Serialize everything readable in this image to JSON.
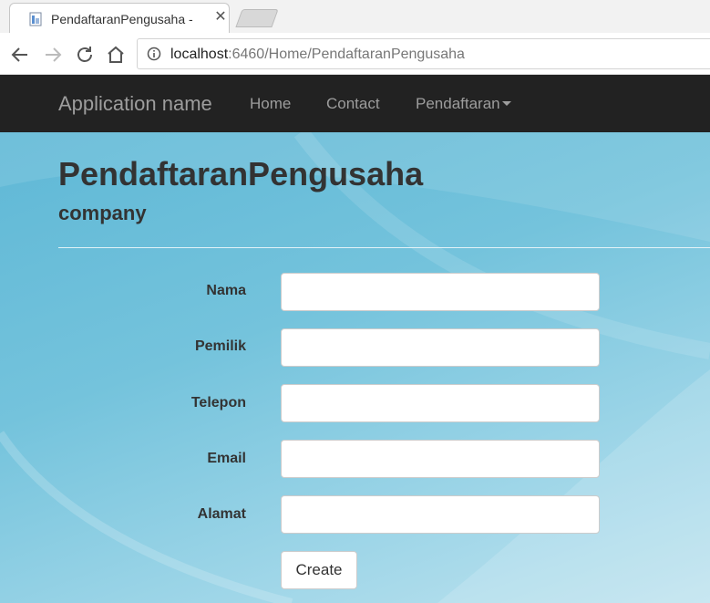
{
  "browser": {
    "tab_title": "PendaftaranPengusaha -",
    "url_host": "localhost",
    "url_rest": ":6460/Home/PendaftaranPengusaha"
  },
  "navbar": {
    "brand": "Application name",
    "links": [
      {
        "label": "Home"
      },
      {
        "label": "Contact"
      },
      {
        "label": "Pendaftaran"
      }
    ]
  },
  "page": {
    "title": "PendaftaranPengusaha",
    "subtitle": "company"
  },
  "form": {
    "fields": [
      {
        "label": "Nama",
        "value": ""
      },
      {
        "label": "Pemilik",
        "value": ""
      },
      {
        "label": "Telepon",
        "value": ""
      },
      {
        "label": "Email",
        "value": ""
      },
      {
        "label": "Alamat",
        "value": ""
      }
    ],
    "submit_label": "Create"
  }
}
